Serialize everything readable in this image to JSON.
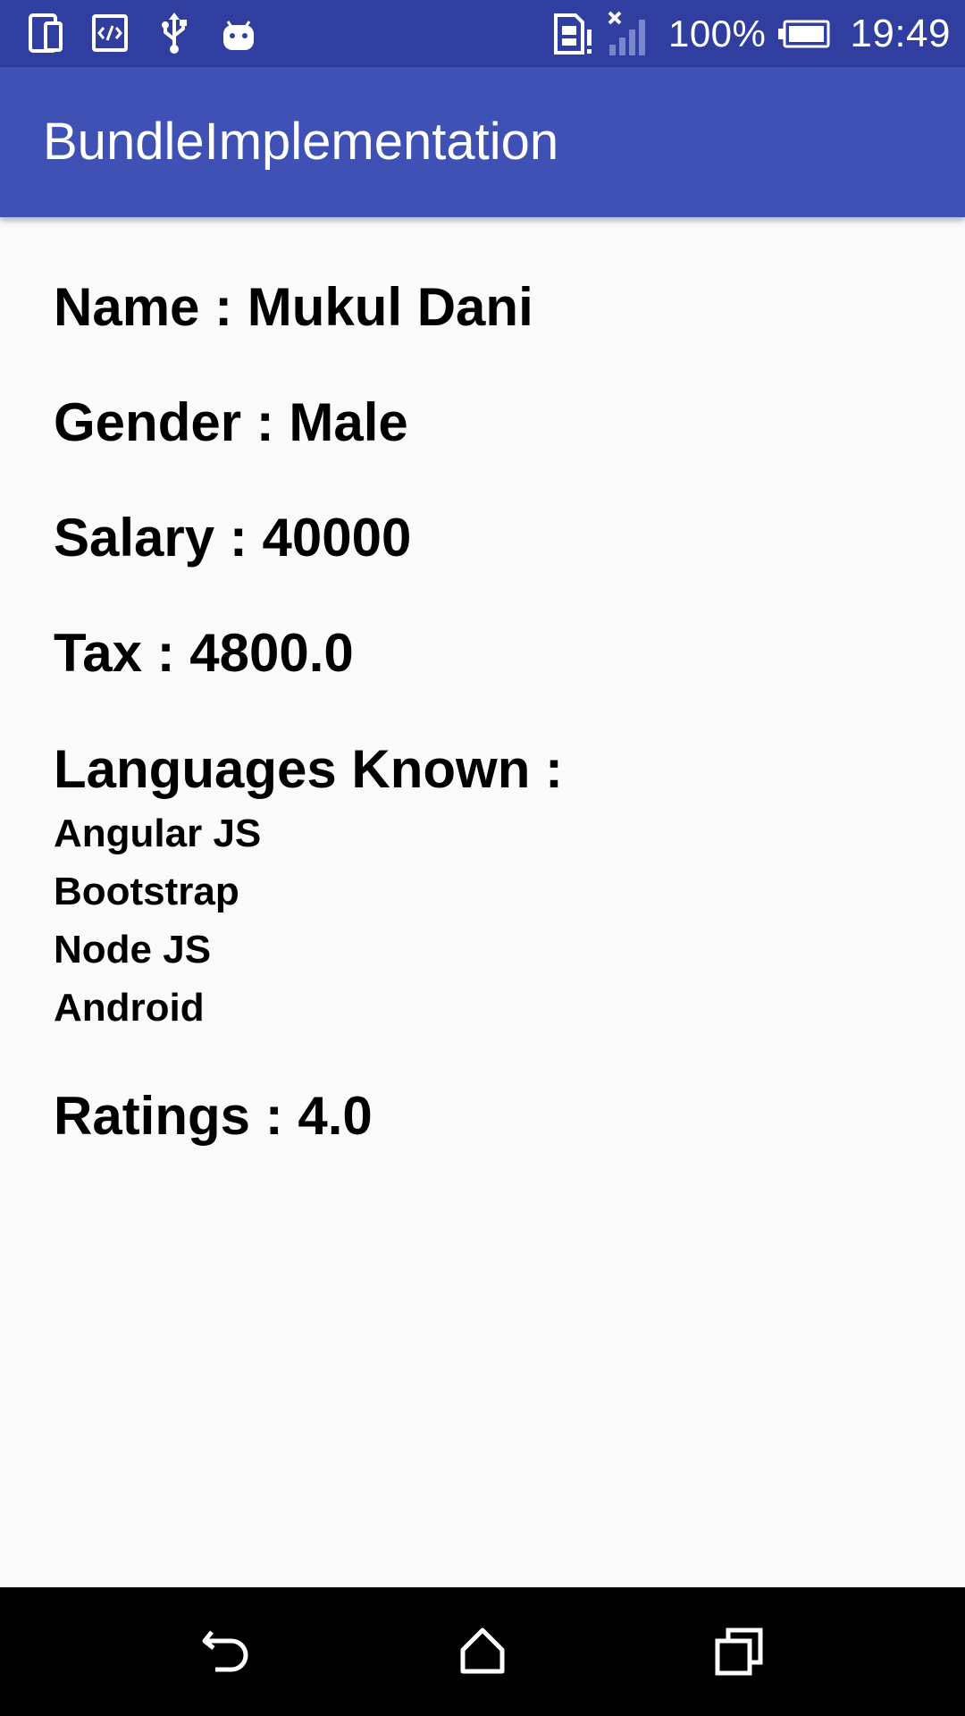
{
  "status_bar": {
    "left_icons": [
      "device-icon",
      "code-icon",
      "usb-icon",
      "android-icon"
    ],
    "right_icons": [
      "sim-alert-icon",
      "signal-icon",
      "battery-icon"
    ],
    "battery_percent": "100%",
    "battery_level": 1.0,
    "time": "19:49",
    "color": "#303f9f"
  },
  "app_bar": {
    "title": "BundleImplementation",
    "color": "#3f51b5"
  },
  "details": {
    "name": "Name : Mukul Dani",
    "gender": "Gender : Male",
    "salary": "Salary : 40000",
    "tax": "Tax : 4800.0",
    "languages_heading": "Languages Known :",
    "languages": [
      "Angular JS",
      "Bootstrap",
      "Node JS",
      "Android"
    ],
    "ratings": "Ratings : 4.0"
  },
  "nav_bar": {
    "buttons": [
      "back-icon",
      "home-icon",
      "recents-icon"
    ],
    "color": "#000000"
  },
  "theme": {
    "background": "#fafafa",
    "text": "#000000"
  }
}
